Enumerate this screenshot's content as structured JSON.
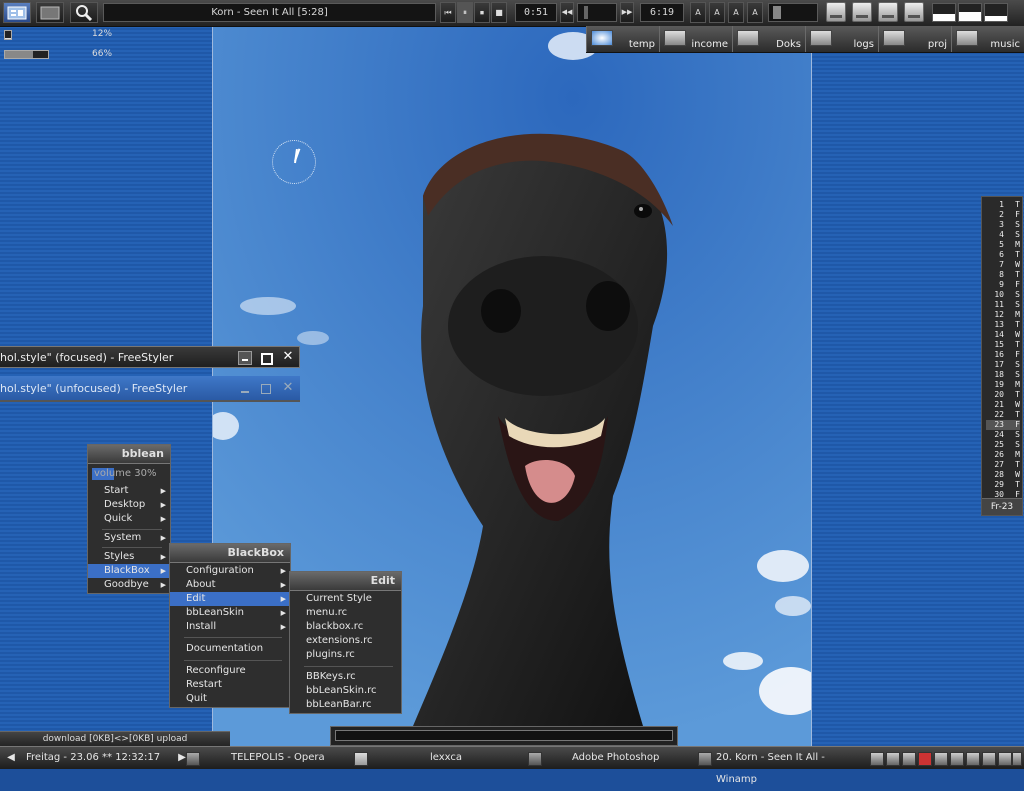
{
  "player": {
    "track": "Korn - Seen It All  [5:28]",
    "elapsed": "0:51",
    "remaining": "6:19",
    "controls": [
      "⏮",
      "⏸",
      "⏹",
      "■",
      "◀◀",
      "▶▶"
    ],
    "eq_labels": [
      "A",
      "A",
      "A",
      "A"
    ]
  },
  "meters": [
    {
      "label": "12%",
      "value": 0.12
    },
    {
      "label": "66%",
      "value": 0.66
    }
  ],
  "quicklaunch": [
    {
      "label": "temp",
      "icon": "ie-icon"
    },
    {
      "label": "income",
      "icon": "folder-icon"
    },
    {
      "label": "Doks",
      "icon": "folder-icon"
    },
    {
      "label": "logs",
      "icon": "folder-icon"
    },
    {
      "label": "proj",
      "icon": "folder-icon"
    },
    {
      "label": "music",
      "icon": "music-folder-icon"
    }
  ],
  "calendar": {
    "days": [
      [
        "1",
        "T"
      ],
      [
        "2",
        "F"
      ],
      [
        "3",
        "S"
      ],
      [
        "4",
        "S"
      ],
      [
        "5",
        "M"
      ],
      [
        "6",
        "T"
      ],
      [
        "7",
        "W"
      ],
      [
        "8",
        "T"
      ],
      [
        "9",
        "F"
      ],
      [
        "10",
        "S"
      ],
      [
        "11",
        "S"
      ],
      [
        "12",
        "M"
      ],
      [
        "13",
        "T"
      ],
      [
        "14",
        "W"
      ],
      [
        "15",
        "T"
      ],
      [
        "16",
        "F"
      ],
      [
        "17",
        "S"
      ],
      [
        "18",
        "S"
      ],
      [
        "19",
        "M"
      ],
      [
        "20",
        "T"
      ],
      [
        "21",
        "W"
      ],
      [
        "22",
        "T"
      ],
      [
        "23",
        "F"
      ],
      [
        "24",
        "S"
      ],
      [
        "25",
        "S"
      ],
      [
        "26",
        "M"
      ],
      [
        "27",
        "T"
      ],
      [
        "28",
        "W"
      ],
      [
        "29",
        "T"
      ],
      [
        "30",
        "F"
      ]
    ],
    "today_index": 22,
    "footer": "Fr-23"
  },
  "freestyler": {
    "focused": "hol.style\" (focused) - FreeStyler",
    "unfocused": "hol.style\" (unfocused) - FreeStyler"
  },
  "menu_root": {
    "title": "bblean",
    "items": [
      {
        "label": "volume 30%",
        "submenu": false
      },
      {
        "label": "Start",
        "submenu": true
      },
      {
        "label": "Desktop",
        "submenu": true
      },
      {
        "label": "Quick",
        "submenu": true
      },
      {
        "label": "System",
        "submenu": true
      },
      {
        "label": "Styles",
        "submenu": true
      },
      {
        "label": "BlackBox",
        "submenu": true
      },
      {
        "label": "Goodbye",
        "submenu": true
      }
    ]
  },
  "menu_blackbox": {
    "title": "BlackBox",
    "items": [
      {
        "label": "Configuration",
        "submenu": true
      },
      {
        "label": "About",
        "submenu": true
      },
      {
        "label": "Edit",
        "submenu": true
      },
      {
        "label": "bbLeanSkin",
        "submenu": true
      },
      {
        "label": "Install",
        "submenu": true
      },
      {
        "label": "Documentation",
        "submenu": false
      },
      {
        "label": "Reconfigure",
        "submenu": false
      },
      {
        "label": "Restart",
        "submenu": false
      },
      {
        "label": "Quit",
        "submenu": false
      }
    ]
  },
  "menu_edit": {
    "title": "Edit",
    "items": [
      {
        "label": "Current Style"
      },
      {
        "label": "menu.rc"
      },
      {
        "label": "blackbox.rc"
      },
      {
        "label": "extensions.rc"
      },
      {
        "label": "plugins.rc"
      },
      {
        "label": "BBKeys.rc"
      },
      {
        "label": "bbLeanSkin.rc"
      },
      {
        "label": "bbLeanBar.rc"
      }
    ]
  },
  "download": "download [0KB]<>[0KB] upload",
  "taskbar": {
    "clock": "Freitag - 23.06 ** 12:32:17",
    "tasks": [
      {
        "label": "TELEPOLIS - Opera",
        "icon": "opera-icon"
      },
      {
        "label": "lexxca",
        "icon": "folder-icon"
      },
      {
        "label": "Adobe Photoshop",
        "icon": "photoshop-icon"
      },
      {
        "label": "20. Korn - Seen It All - Winamp",
        "icon": "winamp-icon"
      }
    ]
  }
}
